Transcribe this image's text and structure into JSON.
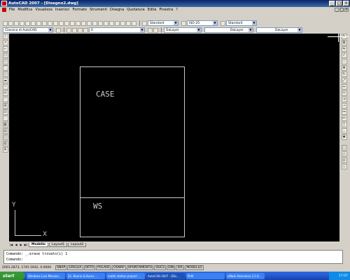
{
  "window": {
    "title": "AutoCAD 2007 - [Disegno2.dwg]"
  },
  "menu": [
    "File",
    "Modifica",
    "Visualizza",
    "Inserisci",
    "Formato",
    "Strumenti",
    "Disegna",
    "Quotatura",
    "Edita",
    "Finestra",
    "?"
  ],
  "toolbar1": {
    "text_style": "Standard",
    "dim_style": "ISO-25",
    "table_style": "Standard"
  },
  "toolbar2": {
    "workspace": "Classica di AutoCAD",
    "layer": "0",
    "color": "DaLayer",
    "linetype": "DaLayer",
    "lineweight": "DaLayer"
  },
  "drawing": {
    "room_label_1": "CASE",
    "room_label_2": "WS",
    "ucs_x": "X",
    "ucs_y": "Y"
  },
  "layout_tabs": [
    "Modello",
    "Layout1",
    "Layout2"
  ],
  "command": {
    "line1": "Comando: _.erase trovato(i) 1",
    "line2": "Comando:"
  },
  "status": {
    "coords": "2001.2873, 1745.5932, 0.0000",
    "buttons": [
      "SNAP",
      "GRIGLIA",
      "ORTO",
      "POLARE",
      "OSNAP",
      "OPUNTAMENTO",
      "DUCS",
      "DIN",
      "SPL",
      "MODELLO"
    ]
  },
  "taskbar": {
    "start": "start",
    "tasks": [
      "Windows Live Messen...",
      "ZL: Boarie & Kurov ...",
      "malte station project ...",
      "AutoCAD 2007 - [Dis...",
      "PLM",
      "eMule Adunanza 3.1.0..."
    ],
    "clock": "17:07"
  }
}
